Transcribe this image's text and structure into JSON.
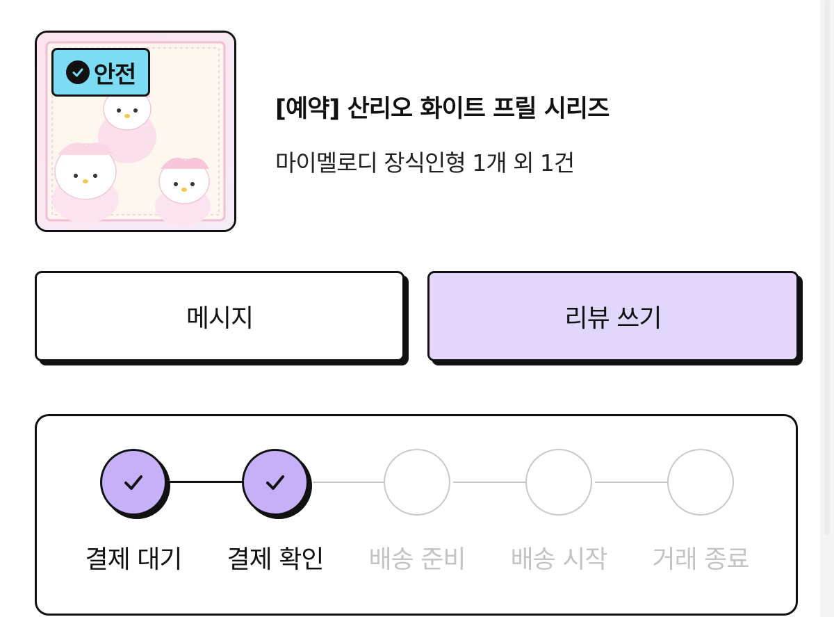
{
  "product": {
    "badge": "안전",
    "title": "[예약] 산리오 화이트 프릴 시리즈",
    "subtitle": "마이멜로디 장식인형 1개 외 1건"
  },
  "actions": {
    "message_label": "메시지",
    "review_label": "리뷰 쓰기"
  },
  "progress": {
    "steps": [
      {
        "label": "결제 대기",
        "status": "done"
      },
      {
        "label": "결제 확인",
        "status": "done"
      },
      {
        "label": "배송 준비",
        "status": "todo"
      },
      {
        "label": "배송 시작",
        "status": "todo"
      },
      {
        "label": "거래 종료",
        "status": "todo"
      }
    ]
  },
  "colors": {
    "badge_bg": "#7cdcf4",
    "review_button_bg": "#e2d6fb",
    "step_done_fill": "#c6b0f8",
    "step_todo_border": "#c9c9c9",
    "step_todo_text": "#c4c4c4"
  },
  "icons": {
    "badge": "check-circle-icon",
    "step_done": "check-icon"
  }
}
